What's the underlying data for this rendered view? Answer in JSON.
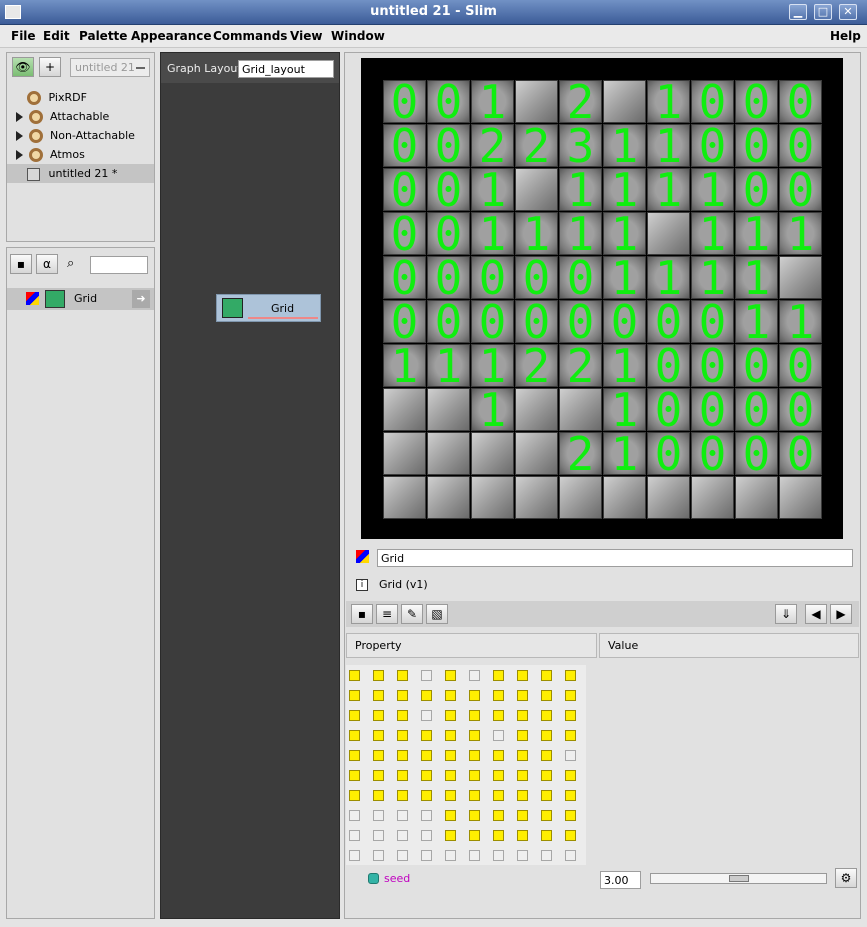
{
  "window": {
    "title": "untitled 21 - Slim",
    "minimize": "▁",
    "maximize": "□",
    "close": "✕"
  },
  "menu": [
    "File",
    "Edit",
    "Palette",
    "Appearance",
    "Commands",
    "View",
    "Window"
  ],
  "help": "Help",
  "library": {
    "combo_value": "untitled 21",
    "tree": [
      {
        "label": "PixRDF",
        "expand": false,
        "icon": "gear-icon"
      },
      {
        "label": "Attachable",
        "expand": true,
        "icon": "gear-icon"
      },
      {
        "label": "Non-Attachable",
        "expand": true,
        "icon": "gear-icon"
      },
      {
        "label": "Atmos",
        "expand": true,
        "icon": "gear-icon"
      },
      {
        "label": "untitled 21 *",
        "expand": false,
        "icon": "grid-icon",
        "selected": true
      }
    ]
  },
  "components": {
    "search_value": "",
    "item": "Grid"
  },
  "graph": {
    "label": "Graph Layout",
    "layout_value": "Grid_layout",
    "node_label": "Grid"
  },
  "grid_rows": [
    [
      "0",
      "0",
      "1",
      "",
      "2",
      "",
      "1",
      "0",
      "0",
      "0"
    ],
    [
      "0",
      "0",
      "2",
      "2",
      "3",
      "1",
      "1",
      "0",
      "0",
      "0"
    ],
    [
      "0",
      "0",
      "1",
      "",
      "1",
      "1",
      "1",
      "1",
      "0",
      "0"
    ],
    [
      "0",
      "0",
      "1",
      "1",
      "1",
      "1",
      "",
      "1",
      "1",
      "1"
    ],
    [
      "0",
      "0",
      "0",
      "0",
      "0",
      "1",
      "1",
      "1",
      "1",
      ""
    ],
    [
      "0",
      "0",
      "0",
      "0",
      "0",
      "0",
      "0",
      "0",
      "1",
      "1"
    ],
    [
      "1",
      "1",
      "1",
      "2",
      "2",
      "1",
      "0",
      "0",
      "0",
      "0"
    ],
    [
      "",
      "",
      "1",
      "",
      "",
      "1",
      "0",
      "0",
      "0",
      "0"
    ],
    [
      "",
      "",
      "",
      "",
      "2",
      "1",
      "0",
      "0",
      "0",
      "0"
    ],
    [
      "",
      "",
      "",
      "",
      "",
      "",
      "",
      "",
      "",
      ""
    ]
  ],
  "raised_cells": [
    [
      0,
      3
    ],
    [
      0,
      5
    ],
    [
      2,
      3
    ],
    [
      3,
      6
    ],
    [
      4,
      9
    ],
    [
      7,
      0
    ],
    [
      7,
      1
    ],
    [
      7,
      3
    ],
    [
      7,
      4
    ],
    [
      8,
      0
    ],
    [
      8,
      1
    ],
    [
      8,
      2
    ],
    [
      8,
      3
    ],
    [
      9,
      0
    ],
    [
      9,
      1
    ],
    [
      9,
      2
    ],
    [
      9,
      3
    ],
    [
      9,
      4
    ],
    [
      9,
      5
    ],
    [
      9,
      6
    ],
    [
      9,
      7
    ],
    [
      9,
      8
    ],
    [
      9,
      9
    ]
  ],
  "inspector": {
    "name_value": "Grid",
    "type_label": "Grid (v1)",
    "info_icon": "i"
  },
  "props": {
    "col_property": "Property",
    "col_value": "Value",
    "seed_label": "seed",
    "seed_value": "3.00",
    "slider_fraction": 0.5
  },
  "checks": [
    [
      1,
      1,
      1,
      0,
      1,
      0,
      1,
      1,
      1,
      1
    ],
    [
      1,
      1,
      1,
      1,
      1,
      1,
      1,
      1,
      1,
      1
    ],
    [
      1,
      1,
      1,
      0,
      1,
      1,
      1,
      1,
      1,
      1
    ],
    [
      1,
      1,
      1,
      1,
      1,
      1,
      0,
      1,
      1,
      1
    ],
    [
      1,
      1,
      1,
      1,
      1,
      1,
      1,
      1,
      1,
      0
    ],
    [
      1,
      1,
      1,
      1,
      1,
      1,
      1,
      1,
      1,
      1
    ],
    [
      1,
      1,
      1,
      1,
      1,
      1,
      1,
      1,
      1,
      1
    ],
    [
      0,
      0,
      0,
      0,
      1,
      1,
      1,
      1,
      1,
      1
    ],
    [
      0,
      0,
      0,
      0,
      1,
      1,
      1,
      1,
      1,
      1
    ],
    [
      0,
      0,
      0,
      0,
      0,
      0,
      0,
      0,
      0,
      0
    ]
  ],
  "colors": {
    "digit": "#10ee10",
    "check_on": "#ffef00",
    "seed_chip": "#33b3a6",
    "seed_text": "#c000c0"
  }
}
